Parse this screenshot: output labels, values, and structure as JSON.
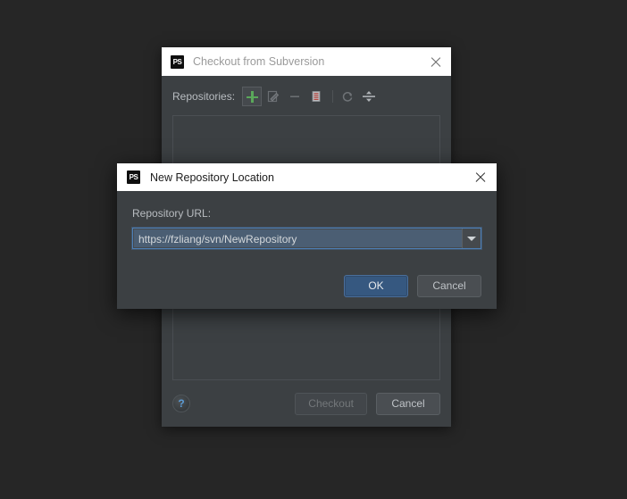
{
  "outer_dialog": {
    "icon": "ps-app-icon",
    "title": "Checkout from Subversion",
    "close_icon": "close-icon",
    "repositories_label": "Repositories:",
    "toolbar": [
      {
        "name": "add-repository-button",
        "icon": "plus-icon",
        "glyph": ""
      },
      {
        "name": "edit-repository-button",
        "icon": "edit-icon",
        "glyph": "✎"
      },
      {
        "name": "remove-repository-button",
        "icon": "minus-icon",
        "glyph": "—"
      },
      {
        "name": "copy-repository-button",
        "icon": "document-icon",
        "glyph": "☷"
      },
      {
        "name": "refresh-button",
        "icon": "refresh-icon",
        "glyph": "↻"
      },
      {
        "name": "collapse-all-button",
        "icon": "collapse-all-icon",
        "glyph": "≡"
      }
    ],
    "footer": {
      "help_label": "?",
      "checkout_label": "Checkout",
      "cancel_label": "Cancel"
    }
  },
  "inner_dialog": {
    "icon": "ps-app-icon",
    "title": "New Repository Location",
    "close_icon": "close-icon",
    "url_label": "Repository URL:",
    "url_value": "https://fzliang/svn/NewRepository",
    "url_placeholder": "https://",
    "dropdown_icon": "chevron-down-icon",
    "ok_label": "OK",
    "cancel_label": "Cancel"
  },
  "colors": {
    "page_background": "#262626",
    "dialog_background": "#3c4043",
    "titlebar_background": "#ffffff",
    "accent_blue": "#365880",
    "focus_border": "#4d7fb5",
    "selection_blue": "#4b5e73",
    "plus_green": "#5aa85a",
    "help_blue": "#5b9bd5"
  }
}
